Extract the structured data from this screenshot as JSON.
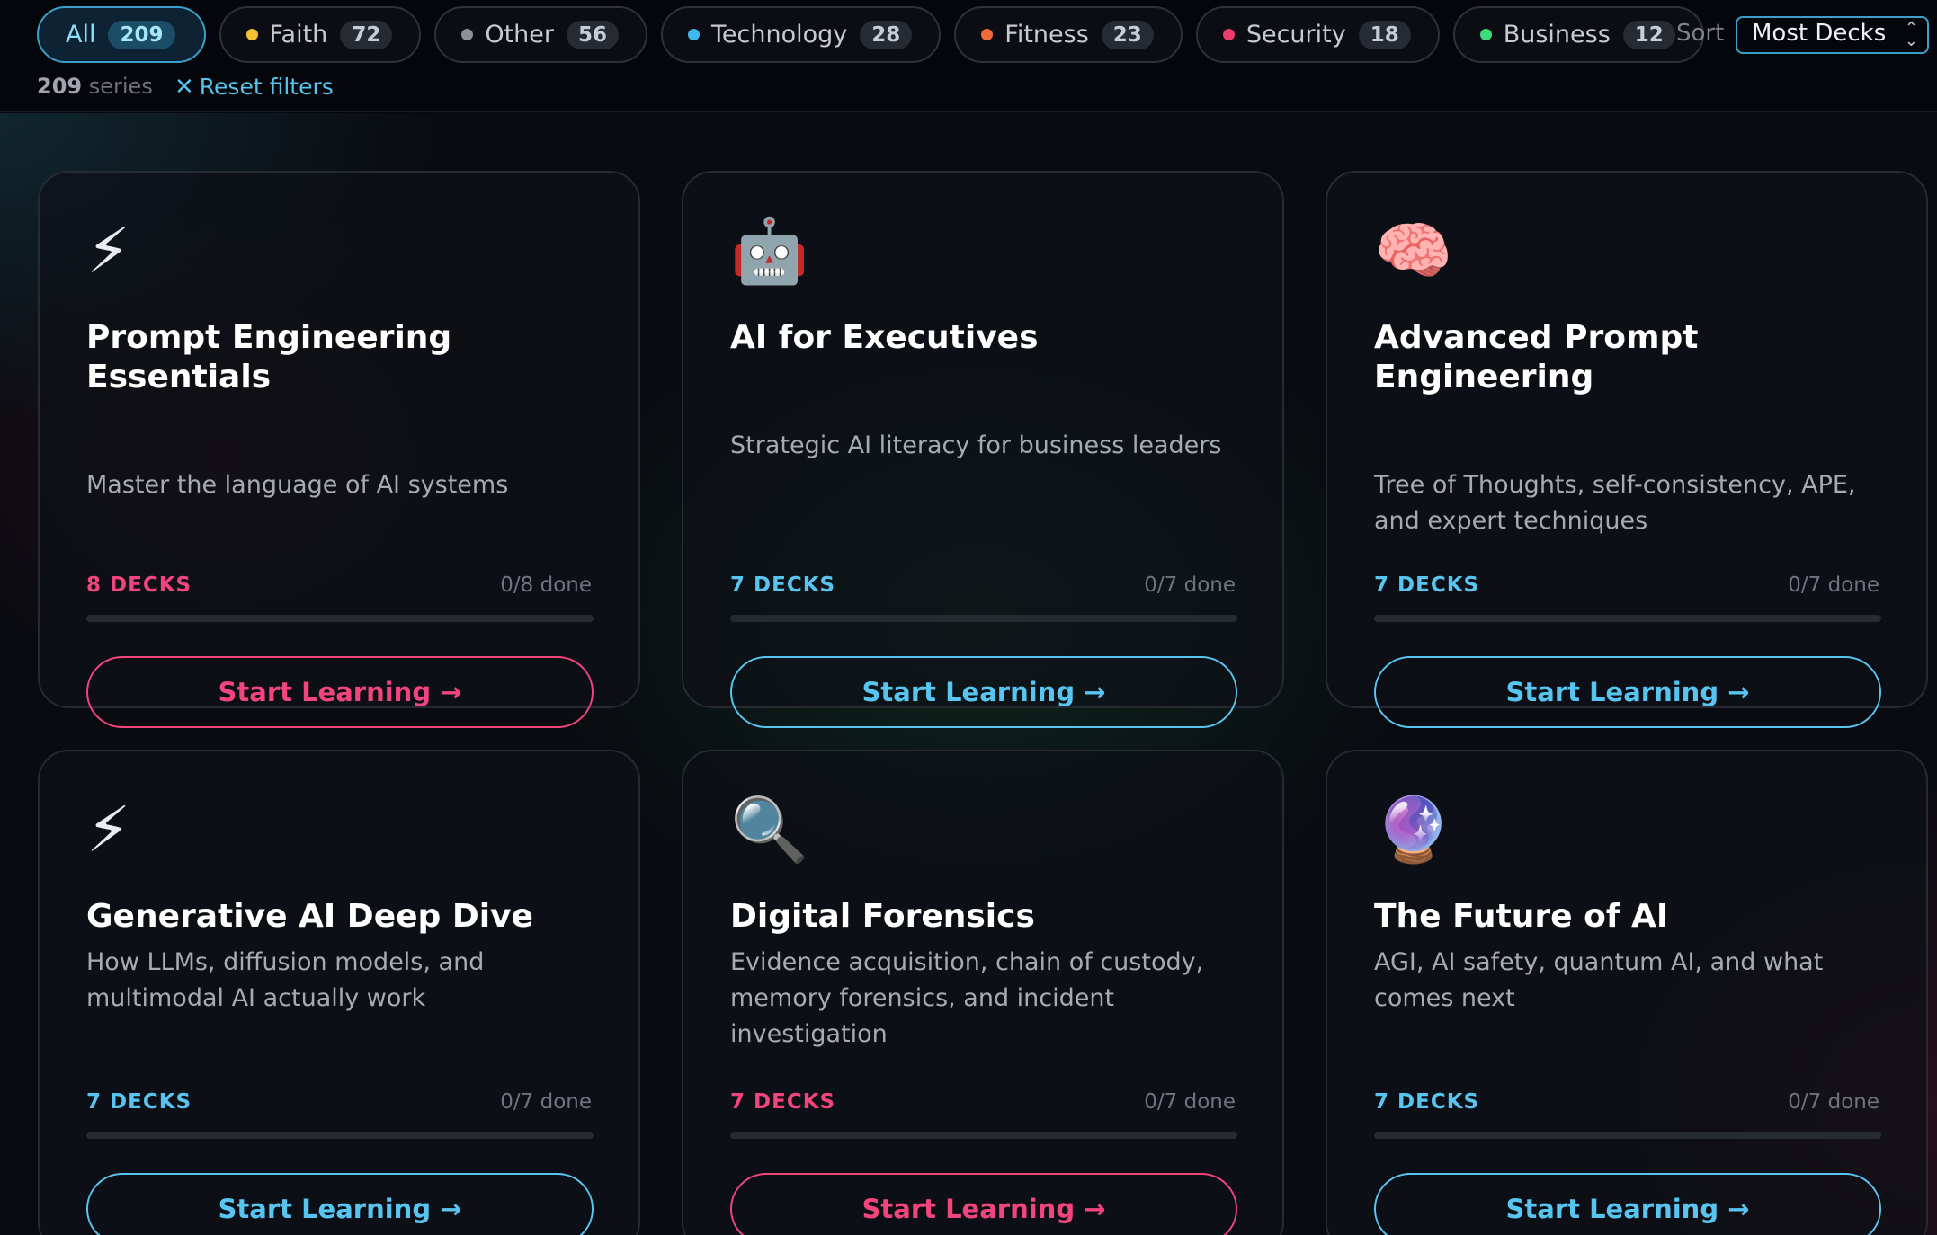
{
  "filters": [
    {
      "label": "All",
      "count": "209",
      "active": true,
      "dot": ""
    },
    {
      "label": "Faith",
      "count": "72",
      "active": false,
      "dot": "#f2c232"
    },
    {
      "label": "Other",
      "count": "56",
      "active": false,
      "dot": "#8c9099"
    },
    {
      "label": "Technology",
      "count": "28",
      "active": false,
      "dot": "#3fb8ec"
    },
    {
      "label": "Fitness",
      "count": "23",
      "active": false,
      "dot": "#f06a3a"
    },
    {
      "label": "Security",
      "count": "18",
      "active": false,
      "dot": "#ef3a6c"
    },
    {
      "label": "Business",
      "count": "12",
      "active": false,
      "dot": "#3ddc7d"
    }
  ],
  "sort": {
    "label": "Sort",
    "value": "Most Decks"
  },
  "summary": {
    "count": "209",
    "unit": "series",
    "reset": "Reset filters"
  },
  "colors": {
    "accent": "#3aa0c9",
    "pink": "#f2457d",
    "blue": "#58c4f0"
  },
  "cards": [
    {
      "emoji": "⚡",
      "icon": "lightning-icon",
      "title": "Prompt Engineering Essentials",
      "desc": "Master the language of AI systems",
      "decks": "8 DECKS",
      "done": "0/8 done",
      "progress": 0,
      "button": "Start Learning →",
      "accent": "pink"
    },
    {
      "emoji": "🤖",
      "icon": "robot-icon",
      "title": "AI for Executives",
      "desc": "Strategic AI literacy for business leaders",
      "decks": "7 DECKS",
      "done": "0/7 done",
      "progress": 0,
      "button": "Start Learning →",
      "accent": "blue"
    },
    {
      "emoji": "🧠",
      "icon": "brain-icon",
      "title": "Advanced Prompt Engineering",
      "desc": "Tree of Thoughts, self-consistency, APE, and expert techniques",
      "decks": "7 DECKS",
      "done": "0/7 done",
      "progress": 0,
      "button": "Start Learning →",
      "accent": "blue"
    },
    {
      "emoji": "⚡",
      "icon": "lightning-icon",
      "title": "Generative AI Deep Dive",
      "desc": "How LLMs, diffusion models, and multimodal AI actually work",
      "decks": "7 DECKS",
      "done": "0/7 done",
      "progress": 0,
      "button": "Start Learning →",
      "accent": "blue"
    },
    {
      "emoji": "🔍",
      "icon": "magnifier-icon",
      "title": "Digital Forensics",
      "desc": "Evidence acquisition, chain of custody, memory forensics, and incident investigation",
      "decks": "7 DECKS",
      "done": "0/7 done",
      "progress": 0,
      "button": "Start Learning →",
      "accent": "pink"
    },
    {
      "emoji": "🔮",
      "icon": "crystal-ball-icon",
      "title": "The Future of AI",
      "desc": "AGI, AI safety, quantum AI, and what comes next",
      "decks": "7 DECKS",
      "done": "0/7 done",
      "progress": 0,
      "button": "Start Learning →",
      "accent": "blue"
    }
  ]
}
